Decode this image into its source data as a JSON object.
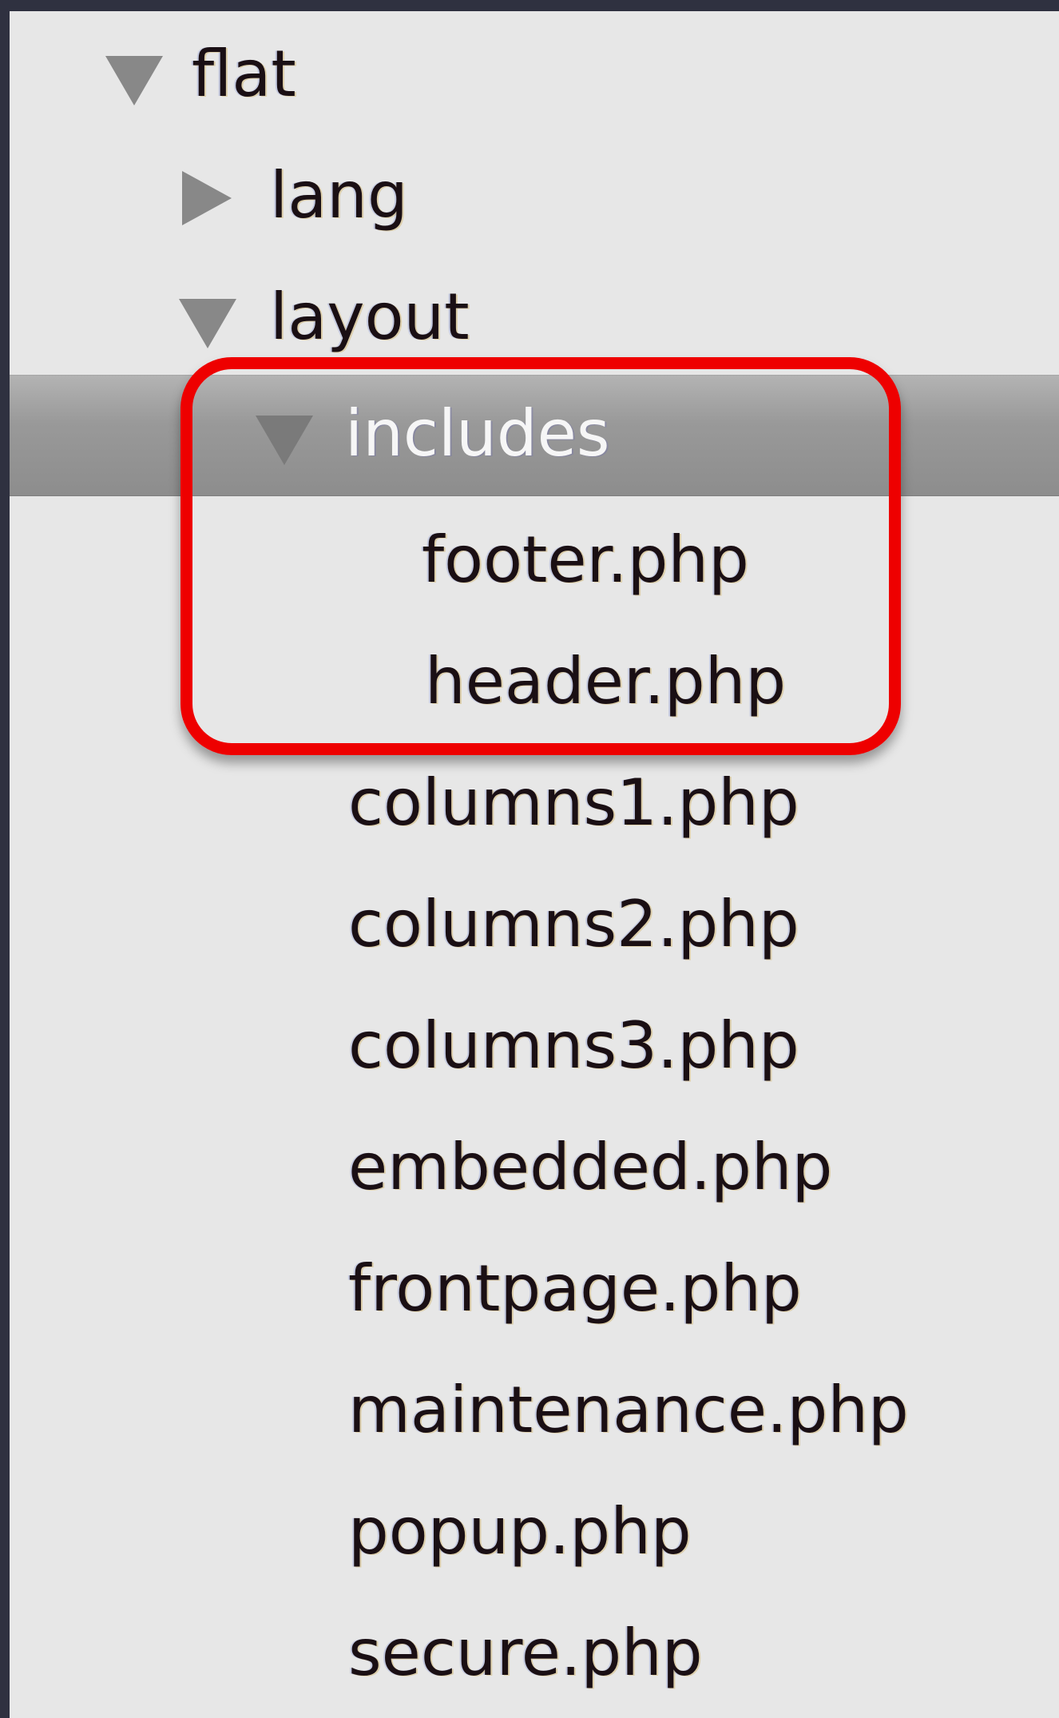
{
  "tree": {
    "items": [
      {
        "label": "flat",
        "state": "expanded",
        "selected": false
      },
      {
        "label": "lang",
        "state": "collapsed",
        "selected": false
      },
      {
        "label": "layout",
        "state": "expanded",
        "selected": false
      },
      {
        "label": "includes",
        "state": "expanded",
        "selected": true
      },
      {
        "label": "footer.php",
        "state": "file",
        "selected": false
      },
      {
        "label": "header.php",
        "state": "file",
        "selected": false
      },
      {
        "label": "columns1.php",
        "state": "file",
        "selected": false
      },
      {
        "label": "columns2.php",
        "state": "file",
        "selected": false
      },
      {
        "label": "columns3.php",
        "state": "file",
        "selected": false
      },
      {
        "label": "embedded.php",
        "state": "file",
        "selected": false
      },
      {
        "label": "frontpage.php",
        "state": "file",
        "selected": false
      },
      {
        "label": "maintenance.php",
        "state": "file",
        "selected": false
      },
      {
        "label": "popup.php",
        "state": "file",
        "selected": false
      },
      {
        "label": "secure.php",
        "state": "file",
        "selected": false
      }
    ]
  },
  "annotation": {
    "highlight_color": "#ee0000"
  },
  "colors": {
    "panel_background": "#e7e7e7",
    "frame": "#2f3140",
    "selection": "#9a9a9a",
    "disclosure_triangle": "#888888"
  }
}
